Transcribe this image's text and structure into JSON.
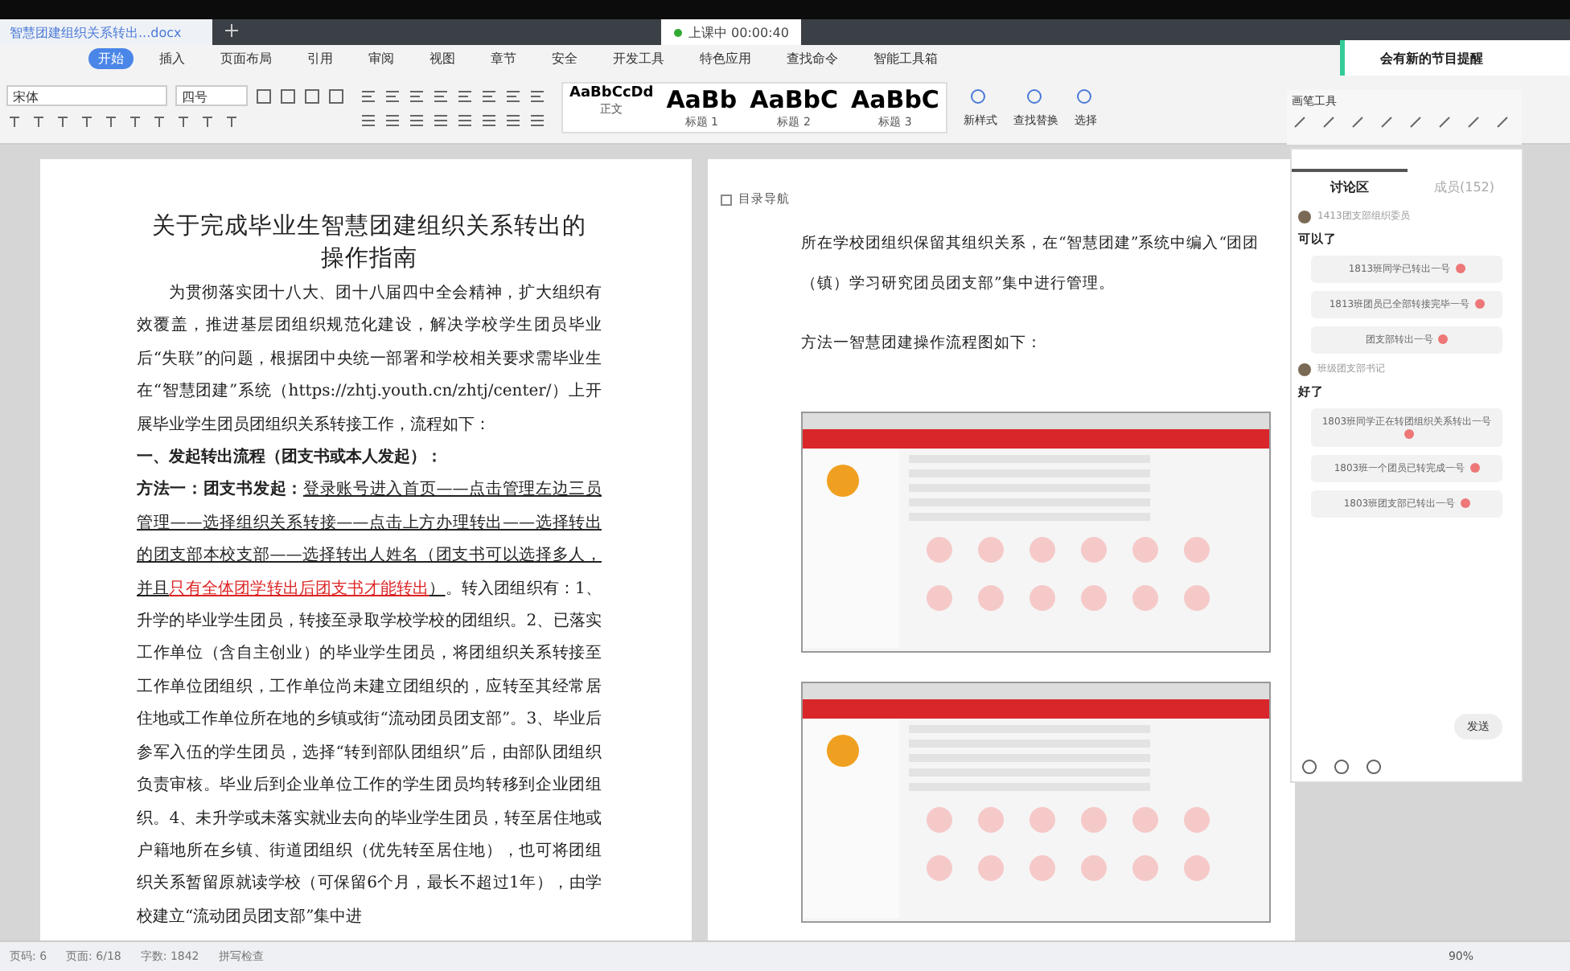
{
  "doc_tab": {
    "title": "智慧团建组织关系转出...docx"
  },
  "recording": {
    "label": "上课中 00:00:40"
  },
  "menu": [
    {
      "label": "开始",
      "selected": true
    },
    {
      "label": "插入",
      "selected": false
    },
    {
      "label": "页面布局",
      "selected": false
    },
    {
      "label": "引用",
      "selected": false
    },
    {
      "label": "审阅",
      "selected": false
    },
    {
      "label": "视图",
      "selected": false
    },
    {
      "label": "章节",
      "selected": false
    },
    {
      "label": "安全",
      "selected": false
    },
    {
      "label": "开发工具",
      "selected": false
    },
    {
      "label": "特色应用",
      "selected": false
    },
    {
      "label": "查找命令",
      "selected": false
    },
    {
      "label": "智能工具箱",
      "selected": false
    }
  ],
  "font": {
    "name": "宋体",
    "size": "四号"
  },
  "styles": [
    {
      "preview": "AaBbCcDd",
      "label": "正文"
    },
    {
      "preview": "AaBb",
      "label": "标题 1"
    },
    {
      "preview": "AaBbC",
      "label": "标题 2"
    },
    {
      "preview": "AaBbC",
      "label": "标题 3"
    }
  ],
  "tools": [
    {
      "label": "新样式"
    },
    {
      "label": "查找替换"
    },
    {
      "label": "选择"
    }
  ],
  "notification": "会有新的节目提醒",
  "pen_toolbar": {
    "title": "画笔工具"
  },
  "left_page": {
    "title": "关于完成毕业生智慧团建组织关系转出的操作指南",
    "paragraphs": [
      {
        "kind": "indented",
        "parts": [
          {
            "kind": "plain",
            "text": "为贯彻落实团十八大、团十八届四中全会精神，扩大组织有效覆盖，推进基层团组织规范化建设，解决学校学生团员毕业后“失联”的问题，根据团中央统一部署和学校相关要求需毕业生在“智慧团建”系统（https://zhtj.youth.cn/zhtj/center/）上开展毕业学生团员团组织关系转接工作，流程如下："
          }
        ]
      },
      {
        "kind": "flush",
        "parts": [
          {
            "kind": "bold",
            "text": "一、发起转出流程（团支书或本人发起）："
          }
        ]
      },
      {
        "kind": "flush",
        "parts": [
          {
            "kind": "bold",
            "text": "方法一：团支书发起："
          },
          {
            "kind": "underline",
            "text": "登录账号进入首页——点击管理左边三员管理——选择组织关系转接——点击上方办理转出——选择转出的团支部本校支部——选择转出人姓名（团支书可以选择多人，并且"
          },
          {
            "kind": "red-underline",
            "text": "只有全体团学转出后团支书才能转出"
          },
          {
            "kind": "underline",
            "text": "）"
          },
          {
            "kind": "plain",
            "text": "。转入团组织有：1、升学的毕业学生团员，转接至录取学校学校的团组织。2、已落实工作单位（含自主创业）的毕业学生团员，将团组织关系转接至工作单位团组织，工作单位尚未建立团组织的，应转至其经常居住地或工作单位所在地的乡镇或街“流动团员团支部”。3、毕业后参军入伍的学生团员，选择“转到部队团组织”后，由部队团组织负责审核。毕业后到企业单位工作的学生团员均转移到企业团组织。4、未升学或未落实就业去向的毕业学生团员，转至居住地或户籍地所在乡镇、街道团组织（优先转至居住地），也可将团组织关系暂留原就读学校（可保留6个月，最长不超过1年），由学校建立“流动团员团支部”集中进"
          }
        ]
      }
    ]
  },
  "right_page": {
    "nav_label": "目录导航",
    "paragraphs": [
      "所在学校团组织保留其组织关系，在“智慧团建”系统中编入“团团（镇）学习研究团员团支部”集中进行管理。",
      "方法一智慧团建操作流程图如下："
    ]
  },
  "chat": {
    "tabs": [
      {
        "label": "讨论区",
        "selected": true
      },
      {
        "label": "成员(152)",
        "selected": false
      }
    ],
    "messages": [
      {
        "user": "1413团支部组织委员",
        "text": "可以了",
        "replies": [
          "1813班同学已转出一号",
          "1813班团员已全部转接完毕一号",
          "团支部转出一号"
        ]
      },
      {
        "user": "班级团支部书记",
        "text": "好了",
        "replies": [
          "1803班同学正在转团组织关系转出一号",
          "1803班一个团员已转完成一号",
          "1803班团支部已转出一号"
        ]
      }
    ],
    "send_label": "发送"
  },
  "status_bar": {
    "items": [
      "页码: 6",
      "页面: 6/18",
      "字数: 1842",
      "拼写检查"
    ],
    "zoom": "90%"
  }
}
